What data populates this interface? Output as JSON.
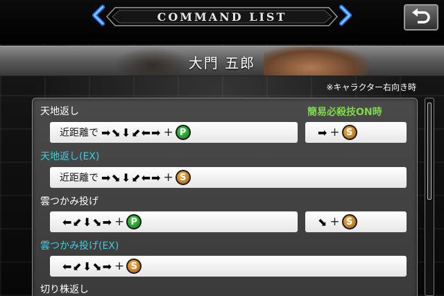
{
  "header": {
    "title": "COMMAND LIST",
    "back_icon": "return-arrow-icon"
  },
  "character": {
    "name": "大門 五郎",
    "prev_icon": "chevron-left-icon",
    "next_icon": "chevron-right-icon"
  },
  "note": "※キャラクター右向き時",
  "simple_header": "簡易必殺技ON時",
  "moves": [
    {
      "name": "天地返し",
      "ex": false,
      "command_prefix": "近距離で",
      "command_glyphs": "➡⬊⬇⬋⬅➡",
      "command_button": "P",
      "simple_glyphs": "➡",
      "simple_button": "S"
    },
    {
      "name": "天地返し(EX)",
      "ex": true,
      "command_prefix": "近距離で",
      "command_glyphs": "➡⬊⬇⬋⬅➡",
      "command_button": "S"
    },
    {
      "name": "雲つかみ投げ",
      "ex": false,
      "command_prefix": "",
      "command_glyphs": "⬅⬋⬇⬊➡",
      "command_button": "P",
      "simple_glyphs": "⬊",
      "simple_button": "S"
    },
    {
      "name": "雲つかみ投げ(EX)",
      "ex": true,
      "command_prefix": "",
      "command_glyphs": "⬅⬋⬇⬊➡",
      "command_button": "S"
    },
    {
      "name": "切り株返し",
      "ex": false
    }
  ],
  "plus_sign": "+",
  "colors": {
    "ex_name": "#37d0e0",
    "simple_header": "#7fd84a",
    "nav_arrow": "#2a7cff",
    "button_p": "#0b7a1a",
    "button_s": "#a2600f"
  }
}
